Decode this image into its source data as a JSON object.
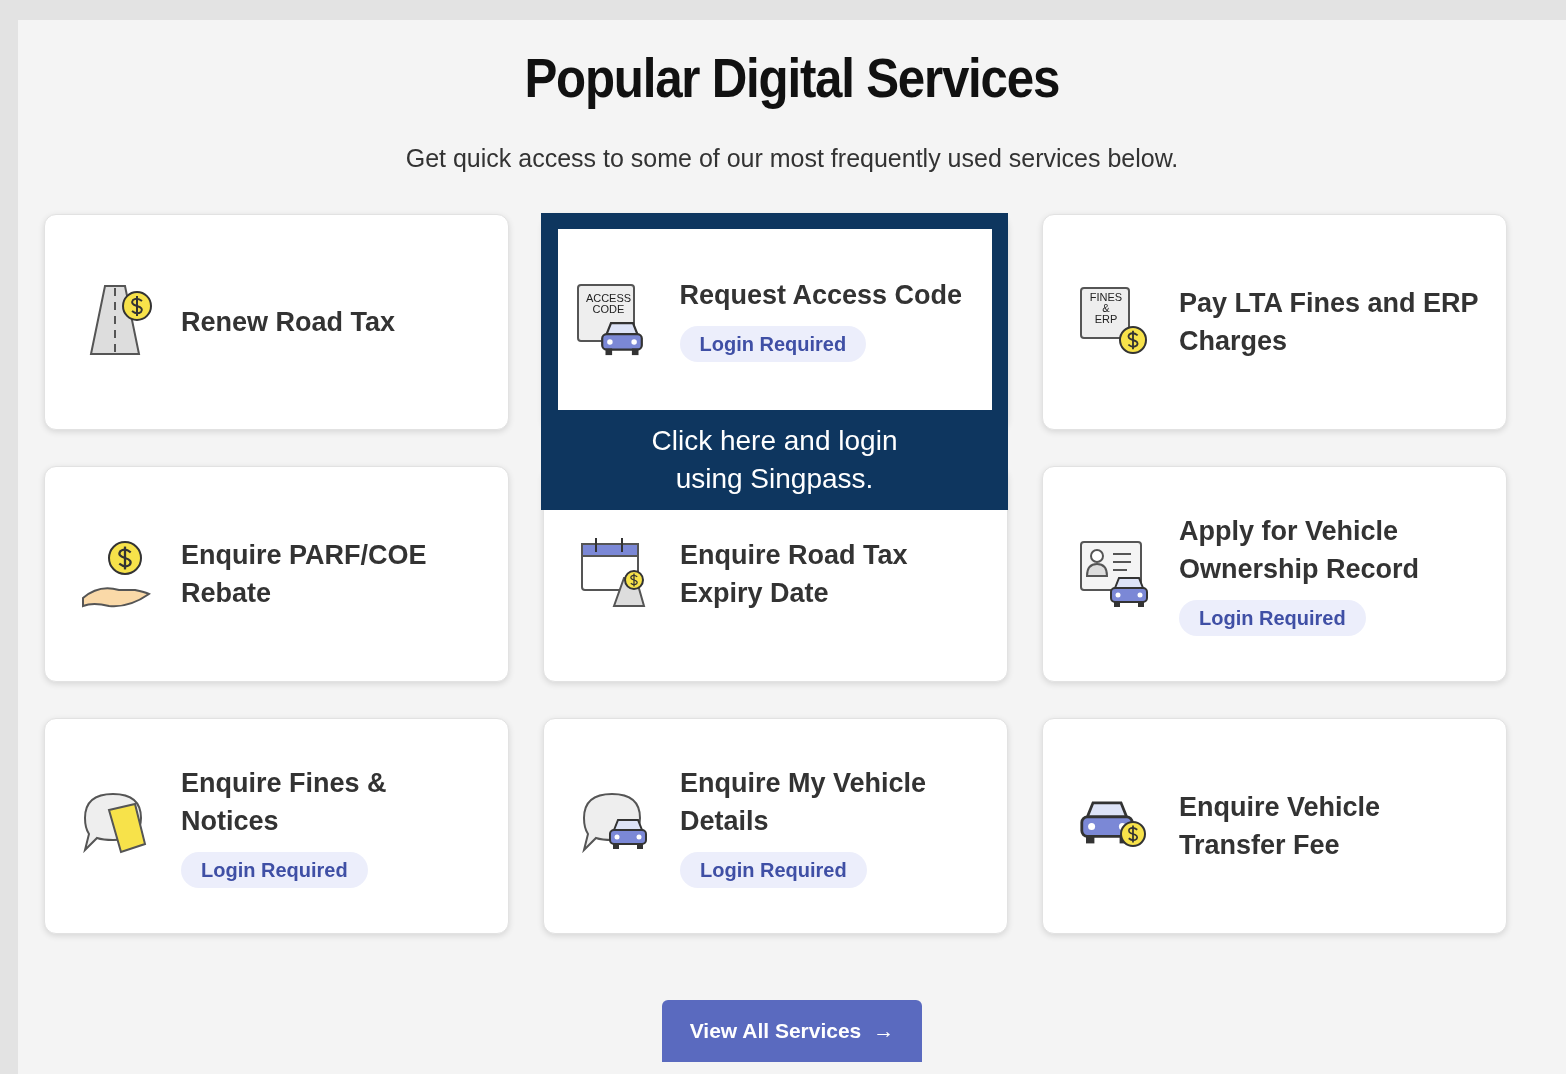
{
  "title": "Popular Digital Services",
  "subtitle": "Get quick access to some of our most frequently used services below.",
  "services": [
    {
      "kind": "road",
      "title": "Renew Road Tax"
    },
    {
      "kind": "access",
      "icon_text": [
        "ACCESS",
        "CODE"
      ],
      "title": "Request Access Code",
      "badge": "Login Required",
      "highlight": {
        "caption": "Click here and login using Singpass."
      }
    },
    {
      "kind": "fines",
      "icon_text": [
        "FINES",
        "&",
        "ERP"
      ],
      "title": "Pay LTA Fines and ERP Charges"
    },
    {
      "kind": "hand",
      "title": "Enquire PARF/COE Rebate"
    },
    {
      "kind": "calendar",
      "title": "Enquire Road Tax Expiry Date"
    },
    {
      "kind": "record",
      "title": "Apply for Vehicle Ownership Record",
      "badge": "Login Required"
    },
    {
      "kind": "bubble-fines",
      "title": "Enquire Fines & Notices",
      "badge": "Login Required"
    },
    {
      "kind": "bubble-car",
      "title": "Enquire My Vehicle Details",
      "badge": "Login Required"
    },
    {
      "kind": "car-coin",
      "title": "Enquire Vehicle Transfer Fee"
    }
  ],
  "button": {
    "label": "View All Services",
    "icon": "→"
  }
}
